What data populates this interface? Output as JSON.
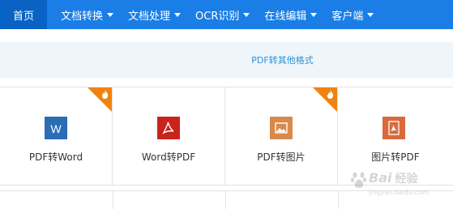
{
  "nav": {
    "home": "首页",
    "items": [
      {
        "label": "文档转换"
      },
      {
        "label": "文档处理"
      },
      {
        "label": "OCR识别"
      },
      {
        "label": "在线编辑"
      },
      {
        "label": "客户端"
      }
    ]
  },
  "subbar": {
    "label": "PDF转其他格式"
  },
  "tools": [
    {
      "label": "PDF转Word",
      "icon": "word-icon",
      "color": "#2b6cb5",
      "hot": true
    },
    {
      "label": "Word转PDF",
      "icon": "pdf-icon",
      "color": "#c9231e",
      "hot": false
    },
    {
      "label": "PDF转图片",
      "icon": "image-icon",
      "color": "#d88a4a",
      "hot": true
    },
    {
      "label": "图片转PDF",
      "icon": "pdf-icon",
      "color": "#d86a3c",
      "hot": false
    }
  ],
  "watermark": {
    "brand": "Bai",
    "suffix": "经验",
    "url": "jingyan.baidu.com"
  },
  "colors": {
    "nav": "#1a7ee6",
    "nav_active": "#0a62c4",
    "hot": "#f0830f"
  }
}
